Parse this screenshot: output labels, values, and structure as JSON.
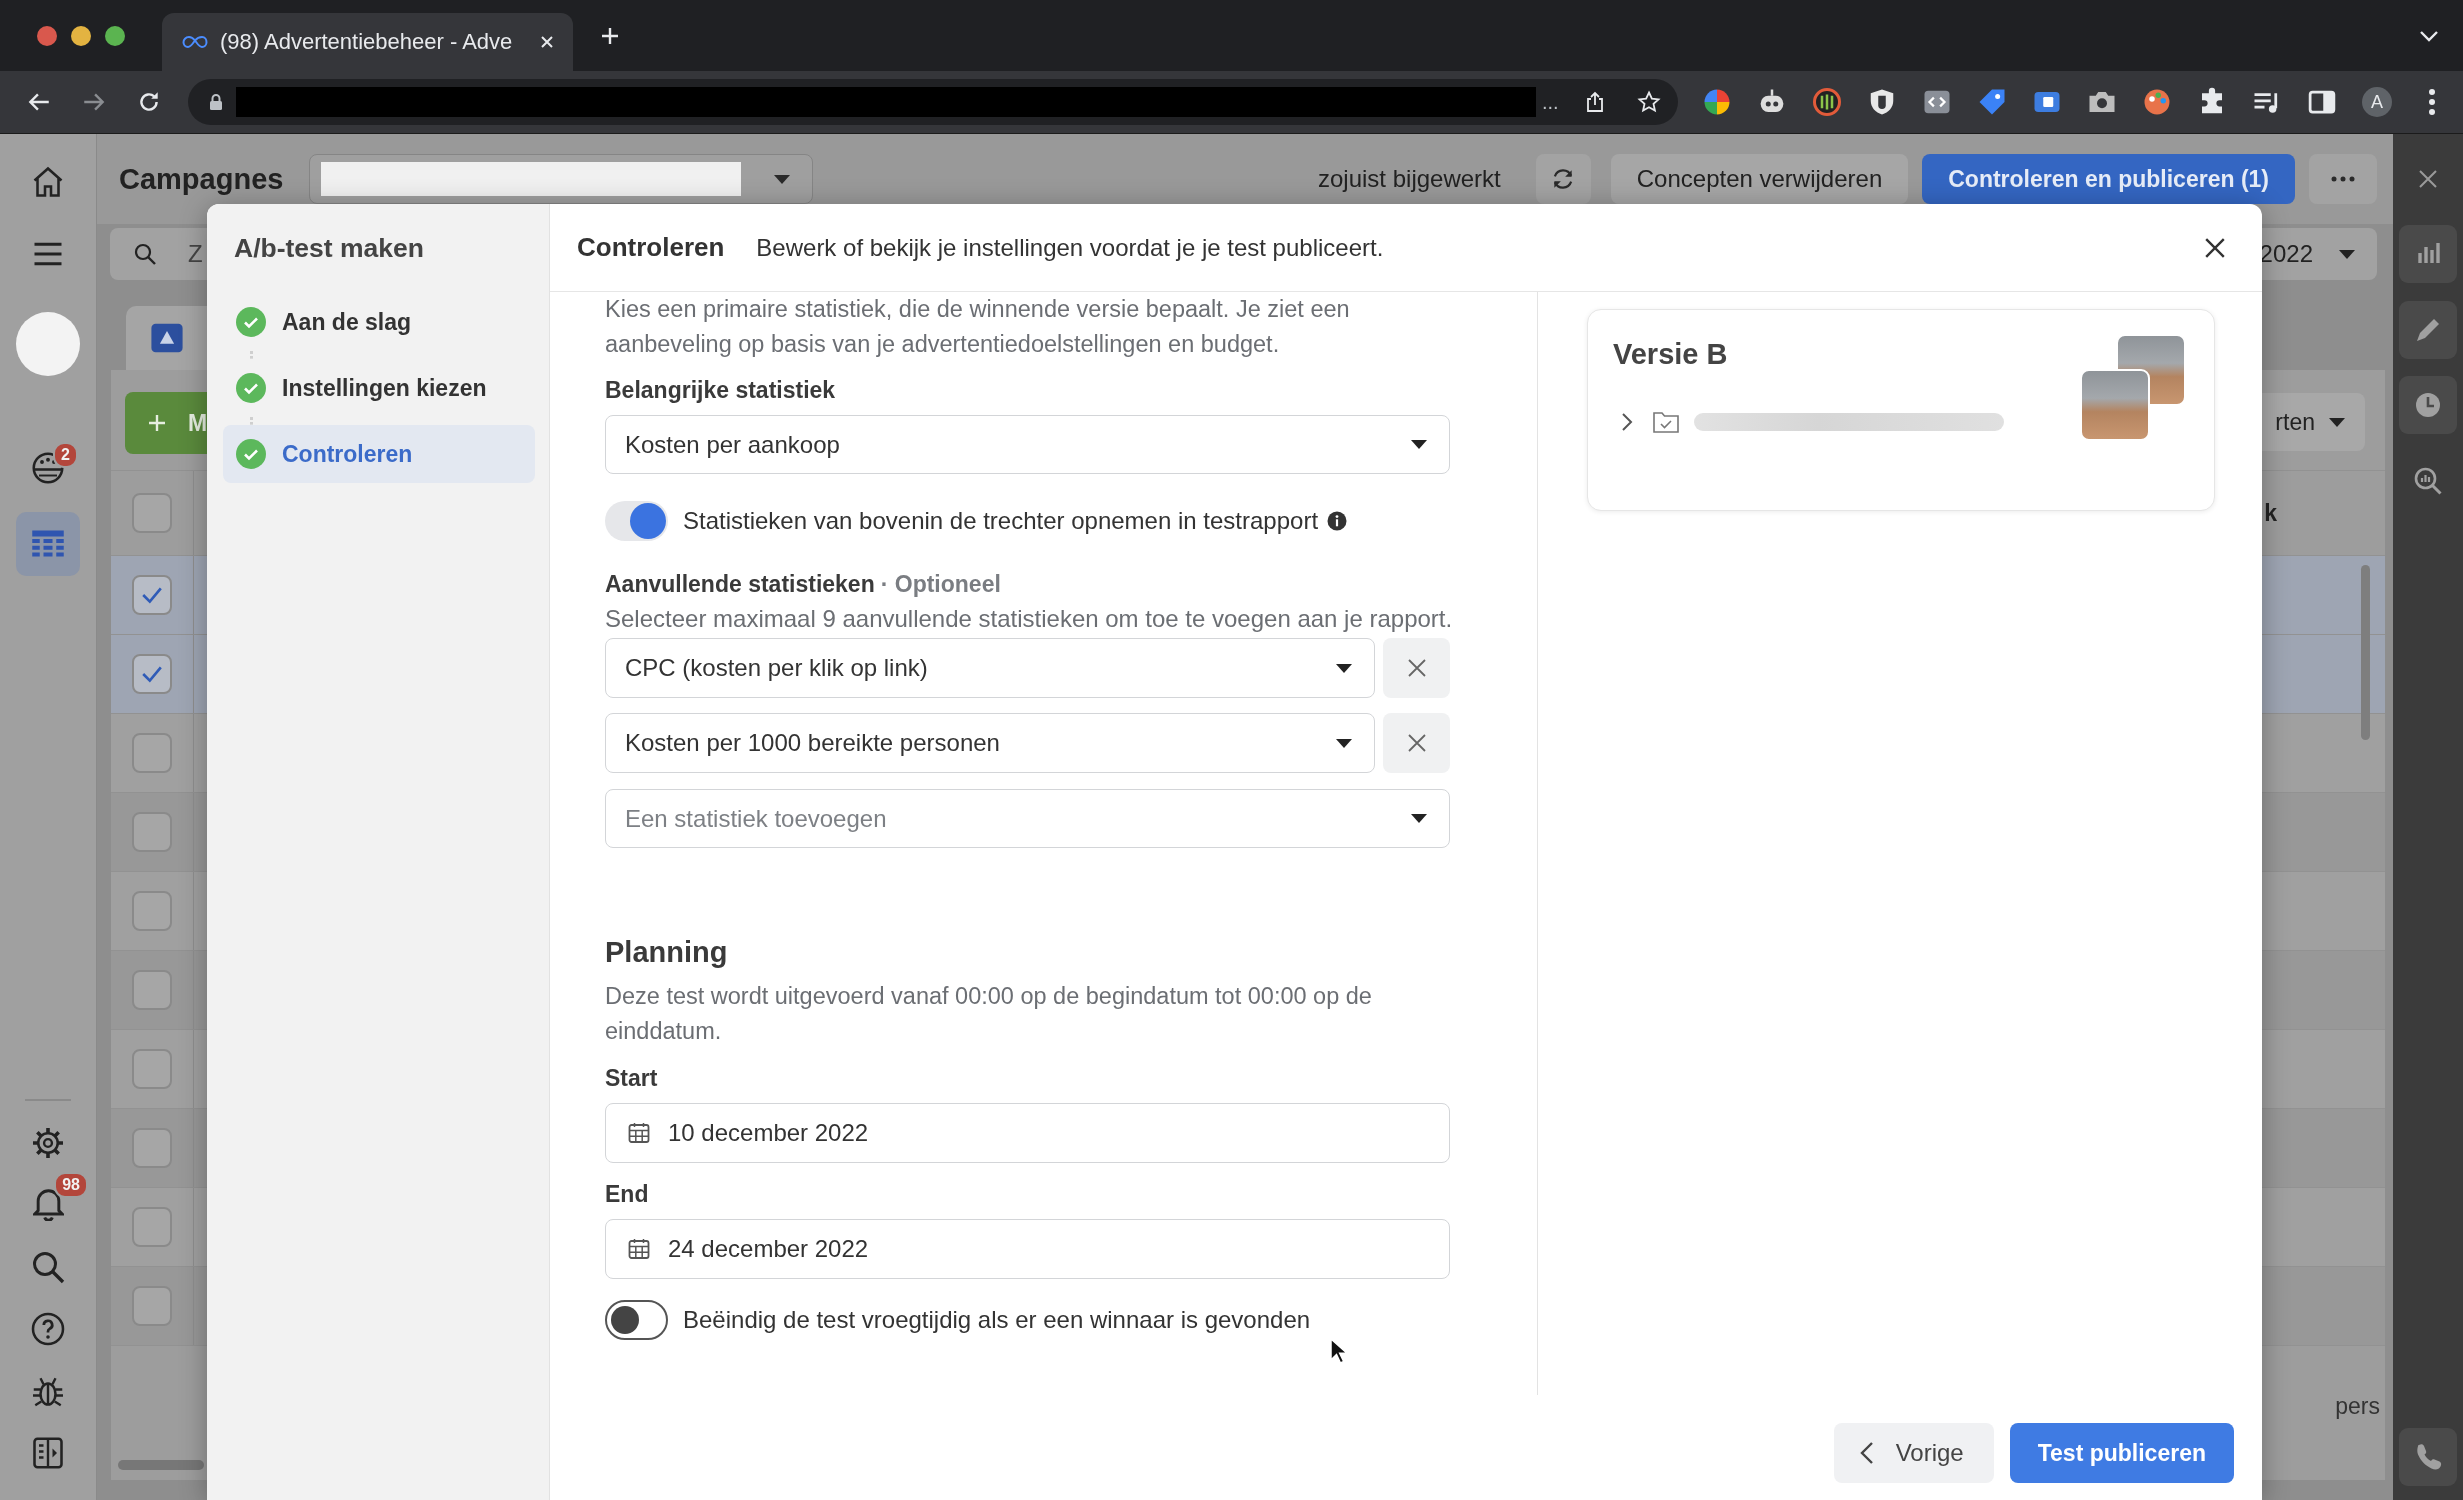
{
  "browser": {
    "tab": {
      "title": "(98) Advertentiebeheer - Adve"
    },
    "address": {
      "ellipsis": "..."
    },
    "profile": {
      "initial": "A"
    }
  },
  "app": {
    "nav": {
      "top_items": [
        {
          "selected": false
        },
        {
          "selected": false
        },
        {
          "selected": false
        },
        {
          "selected": false,
          "badge": "2"
        },
        {
          "selected": true
        }
      ],
      "bottom_items": [
        {
          "selected": false
        },
        {
          "selected": false,
          "badge": "98"
        },
        {
          "selected": false
        },
        {
          "selected": false
        },
        {
          "selected": false
        },
        {
          "selected": false
        }
      ]
    },
    "header": {
      "title": "Campagnes",
      "status": "zojuist bijgewerkt",
      "buttons": [
        {
          "label": "Concepten verwijderen",
          "kind": "secondary"
        },
        {
          "label": "Controleren en publiceren (1)",
          "kind": "primary"
        }
      ]
    },
    "search": {
      "placeholder": "Z"
    },
    "date_range": {
      "label": "2022"
    },
    "table": {
      "create_button": "M",
      "columns_button": "rten",
      "column_heading": "k",
      "header_checked": false,
      "rows": [
        {
          "checked": true
        },
        {
          "checked": true
        },
        {
          "checked": false
        },
        {
          "checked": false
        },
        {
          "checked": false
        },
        {
          "checked": false
        },
        {
          "checked": false
        },
        {
          "checked": false
        },
        {
          "checked": false
        },
        {
          "checked": false
        }
      ],
      "footer_text": "pers"
    }
  },
  "modal": {
    "sidebar": {
      "title": "A/b-test maken",
      "steps": [
        {
          "label": "Aan de slag",
          "done": true,
          "selected": false
        },
        {
          "label": "Instellingen kiezen",
          "done": true,
          "selected": false
        },
        {
          "label": "Controleren",
          "done": true,
          "selected": true
        }
      ]
    },
    "header": {
      "title": "Controleren",
      "subtitle": "Bewerk of bekijk je instellingen voordat je je test publiceert."
    },
    "intro": "Kies een primaire statistiek, die de winnende versie bepaalt. Je ziet een aanbeveling op basis van je advertentiedoelstellingen en budget.",
    "key_metric": {
      "label": "Belangrijke statistiek",
      "value": "Kosten per aankoop"
    },
    "funnel_toggle": {
      "label": "Statistieken van bovenin de trechter opnemen in testrapport",
      "on": true
    },
    "additional_metrics": {
      "label": "Aanvullende statistieken",
      "optional": "· Optioneel",
      "hint": "Selecteer maximaal 9 aanvullende statistieken om toe te voegen aan je rapport.",
      "items": [
        {
          "value": "CPC (kosten per klik op link)"
        },
        {
          "value": "Kosten per 1000 bereikte personen"
        }
      ],
      "add_placeholder": "Een statistiek toevoegen"
    },
    "planning": {
      "title": "Planning",
      "description": "Deze test wordt uitgevoerd vanaf 00:00 op de begindatum tot 00:00 op de einddatum.",
      "start": {
        "label": "Start",
        "value": "10 december 2022"
      },
      "end": {
        "label": "End",
        "value": "24 december 2022"
      }
    },
    "early_end_toggle": {
      "label": "Beëindig de test vroegtijdig als er een winnaar is gevonden",
      "on": false
    },
    "version_card": {
      "title": "Versie B"
    },
    "footer": {
      "back": "Vorige",
      "publish": "Test publiceren"
    }
  }
}
